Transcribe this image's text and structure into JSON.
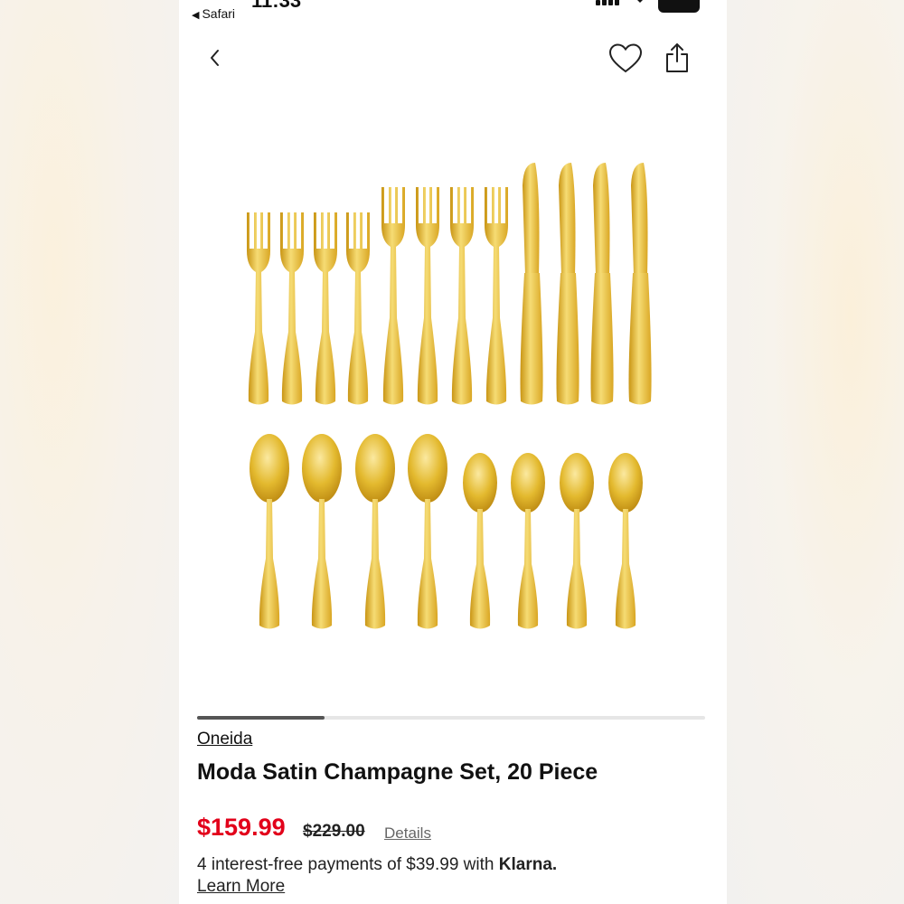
{
  "status_bar": {
    "back_app": "Safari",
    "time": "11:33"
  },
  "product": {
    "brand": "Oneida",
    "title": "Moda Satin Champagne Set, 20 Piece",
    "sale_price": "$159.99",
    "original_price": "$229.00",
    "details_link": "Details",
    "installments_text": "4 interest-free payments of $39.99 with",
    "klarna_label": "Klarna.",
    "learn_more": "Learn More",
    "image_progress": 0.25,
    "image_colors": {
      "gold_light": "#f6dc74",
      "gold_mid": "#e3b92e",
      "gold_dark": "#c99514"
    }
  },
  "icons": {
    "back": "chevron-left-icon",
    "favorite": "heart-outline-icon",
    "share": "share-icon"
  },
  "colors": {
    "sale_price": "#e2001a",
    "progress": "#555555"
  }
}
